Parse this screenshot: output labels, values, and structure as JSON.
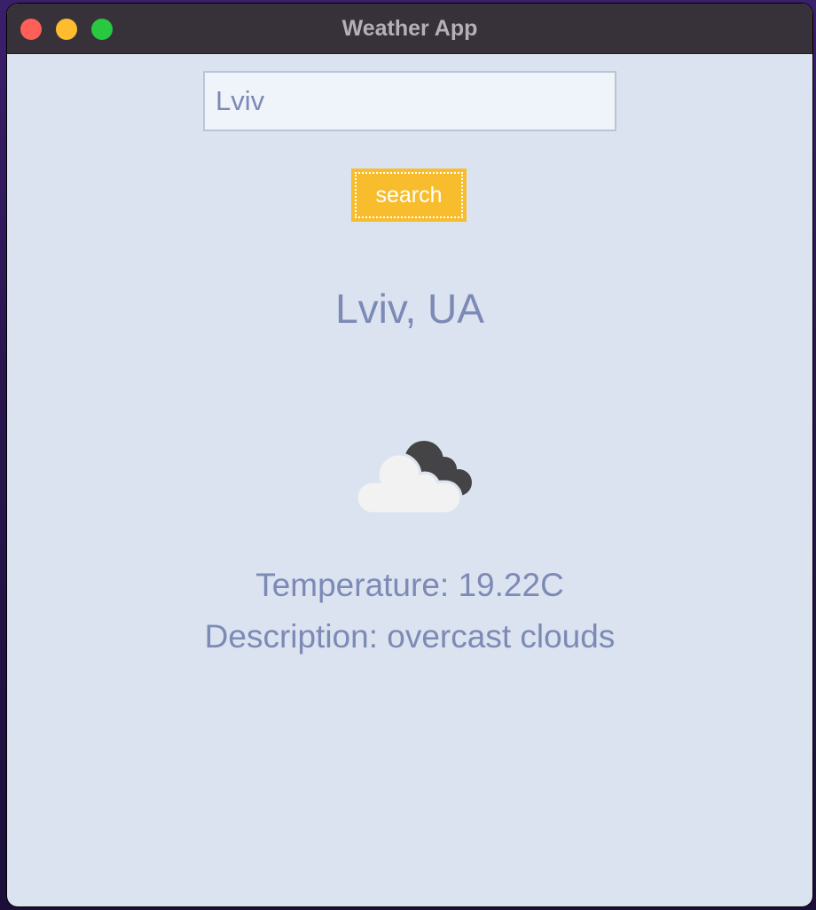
{
  "window": {
    "title": "Weather App"
  },
  "search": {
    "value": "Lviv",
    "button_label": "search"
  },
  "weather": {
    "location": "Lviv, UA",
    "icon": "overcast-clouds-icon",
    "temperature_text": "Temperature: 19.22C",
    "description_text": "Description: overcast clouds"
  },
  "colors": {
    "background": "#dae3ef",
    "accent": "#f7bd2d",
    "text": "#7d8ab6",
    "titlebar": "#37323a"
  }
}
